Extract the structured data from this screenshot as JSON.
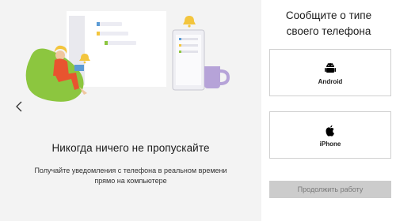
{
  "onboarding": {
    "heading": "Никогда ничего не пропускайте",
    "description_lines": [
      "Получайте уведомления с телефона в реальном времени",
      "прямо на компьютере"
    ],
    "prev_icon": "chevron-left-icon"
  },
  "panel": {
    "title_lines": [
      "Сообщите о типе",
      "своего телефона"
    ],
    "options": [
      {
        "label": "Android",
        "icon": "android-icon"
      },
      {
        "label": "iPhone",
        "icon": "apple-icon"
      }
    ],
    "continue_label": "Продолжить работу"
  },
  "colors": {
    "left_background": "#f3f3f3",
    "continue_disabled": "#cccccc",
    "accent_purple": "#b6a3d8",
    "accent_green": "#8cc63f",
    "accent_yellow": "#f3c53d"
  }
}
